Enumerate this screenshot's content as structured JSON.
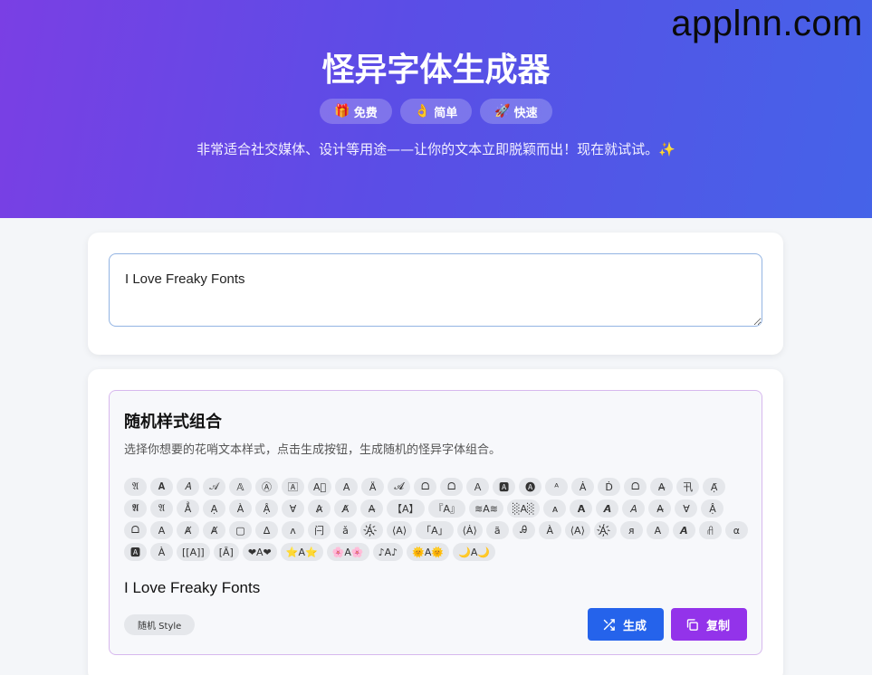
{
  "watermark": "applnn.com",
  "hero": {
    "title": "怪异字体生成器",
    "badges": [
      {
        "icon": "gift-icon",
        "emoji": "🎁",
        "label": "免费"
      },
      {
        "icon": "ok-hand-icon",
        "emoji": "👌",
        "label": "简单"
      },
      {
        "icon": "rocket-icon",
        "emoji": "🚀",
        "label": "快速"
      }
    ],
    "subtitle": "非常适合社交媒体、设计等用途——让你的文本立即脱颖而出！现在就试试。✨"
  },
  "input": {
    "value": "I Love Freaky Fonts"
  },
  "style_panel": {
    "title": "随机样式组合",
    "description": "选择你想要的花哨文本样式，点击生成按钮，生成随机的怪异字体组合。",
    "chips": [
      "𝔄",
      "𝐀",
      "𝐴",
      "𝒜",
      "𝔸",
      "Ⓐ",
      "🄰",
      "A⃞",
      "A",
      "Ä",
      "𝓐",
      "ᗝ",
      "ᗝ",
      "Ａ",
      "🅰",
      "🅐",
      "ᴬ",
      "Ȧ",
      "Ḋ",
      "ᗝ",
      "A̶",
      "卂",
      "Ạ̈",
      "𝕬",
      "𝔄",
      "Ẳ",
      "Ạ",
      "À",
      "Ậ",
      "Ɐ",
      "A̷",
      "A̸",
      "A̶",
      "【A】",
      "『A』",
      "≋A≋",
      "░A░",
      "ᴀ",
      "𝗔",
      "𝘼",
      "𝘈",
      "A̶",
      "Ɐ",
      "Ậ",
      "ᗝ",
      "A",
      "Ⱥ",
      "Ⱥ",
      "▢",
      "∆",
      "ᴧ",
      "闩",
      "ǎ",
      "A҉",
      "⟨A⟩",
      "「A」",
      "⟨Ȧ⟩",
      "ã",
      "Ꭿ",
      "À",
      "⟨A⟩",
      "A҉",
      "ᴙ",
      "A",
      "𝘼",
      "ꋬ",
      "α",
      "🅰",
      "À",
      "[[A]]",
      "[Ā]",
      "❤A❤",
      "⭐A⭐",
      "🌸A🌸",
      "♪A♪",
      "🌞A🌞",
      "🌙A🌙"
    ],
    "output": "I Love Freaky Fonts",
    "style_tag": "随机 Style",
    "generate_label": "生成",
    "copy_label": "复制"
  }
}
